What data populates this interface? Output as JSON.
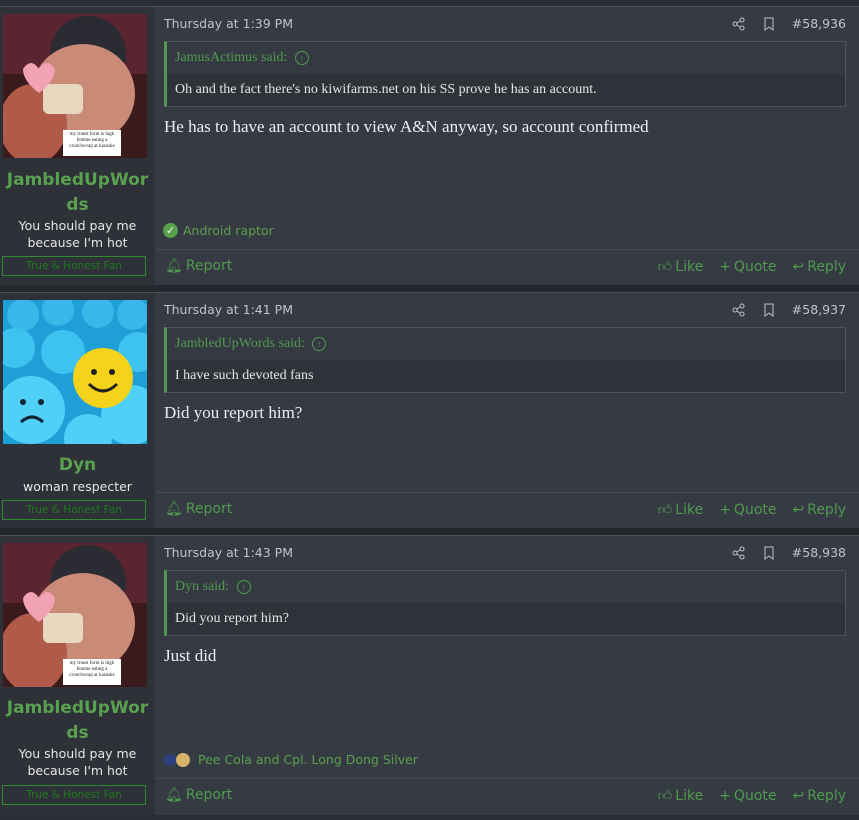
{
  "posts": [
    {
      "user": {
        "name": "JambledUpWords",
        "title": "You should pay me because I'm hot",
        "banner": "True & Honest Fan",
        "avatar_caption": "my truest form is high femme eating a crunchwrap at karaoke"
      },
      "date": "Thursday at 1:39 PM",
      "number": "#58,936",
      "quote": {
        "author": "JamusActimus said:",
        "text": "Oh and the fact there's no kiwifarms.net on his SS prove he has an account."
      },
      "message": "He has to have an account to view A&N anyway, so account confirmed",
      "reactions": "Android raptor"
    },
    {
      "user": {
        "name": "Dyn",
        "title": "woman respecter",
        "banner": "True & Honest Fan"
      },
      "date": "Thursday at 1:41 PM",
      "number": "#58,937",
      "quote": {
        "author": "JambledUpWords said:",
        "text": "I have such devoted fans"
      },
      "message": "Did you report him?"
    },
    {
      "user": {
        "name": "JambledUpWords",
        "title": "You should pay me because I'm hot",
        "banner": "True & Honest Fan",
        "avatar_caption": "my truest form is high femme eating a crunchwrap at karaoke"
      },
      "date": "Thursday at 1:43 PM",
      "number": "#58,938",
      "quote": {
        "author": "Dyn said:",
        "text": "Did you report him?"
      },
      "message": "Just did",
      "reactions": "Pee Cola and Cpl. Long Dong Silver"
    }
  ],
  "actions": {
    "report": "Report",
    "like": "Like",
    "quote": "Quote",
    "reply": "Reply"
  },
  "colors": {
    "accent": "#4f9a4f",
    "background": "#363a42",
    "userpane": "#2e3138"
  }
}
